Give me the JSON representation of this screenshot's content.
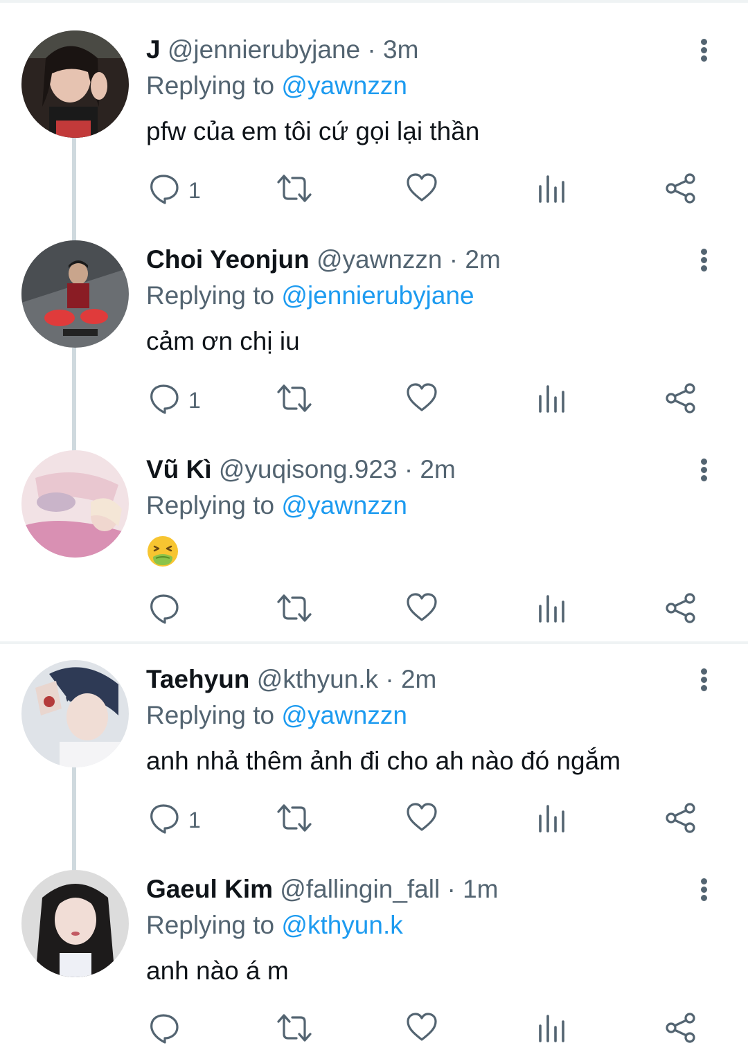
{
  "tweets": [
    {
      "name": "J",
      "handle": "@jennierubyjane",
      "sep": "·",
      "time": "3m",
      "replying_label": "Replying to",
      "replying_to": "@yawnzzn",
      "text": "pfw của em tôi cứ gọi lại thần",
      "reply_count": "1",
      "avatar_colors": [
        "#2b2320",
        "#8a5a4c",
        "#c23a3a"
      ]
    },
    {
      "name": "Choi Yeonjun",
      "handle": "@yawnzzn",
      "sep": "·",
      "time": "2m",
      "replying_label": "Replying to",
      "replying_to": "@jennierubyjane",
      "text": "cảm ơn chị iu",
      "reply_count": "1",
      "avatar_colors": [
        "#5f6366",
        "#3a3d40",
        "#d33"
      ]
    },
    {
      "name": "Vũ Kì",
      "handle": "@yuqisong.923",
      "sep": "·",
      "time": "2m",
      "replying_label": "Replying to",
      "replying_to": "@yawnzzn",
      "text": "",
      "emoji": "nauseated-face",
      "reply_count": "",
      "avatar_colors": [
        "#e9c7d0",
        "#d990b3",
        "#f2e2e5"
      ]
    },
    {
      "name": "Taehyun",
      "handle": "@kthyun.k",
      "sep": "·",
      "time": "2m",
      "replying_label": "Replying to",
      "replying_to": "@yawnzzn",
      "text": "anh nhả thêm ảnh đi cho ah nào đó ngắm",
      "reply_count": "1",
      "avatar_colors": [
        "#2e3a55",
        "#e8d9d4",
        "#b43a3a"
      ]
    },
    {
      "name": "Gaeul Kim",
      "handle": "@fallingin_fall",
      "sep": "·",
      "time": "1m",
      "replying_label": "Replying to",
      "replying_to": "@kthyun.k",
      "text": "anh nào á m",
      "reply_count": "",
      "avatar_colors": [
        "#1d1b1b",
        "#e8d4cf",
        "#c9c9c9"
      ]
    }
  ],
  "icons": {
    "reply": "reply-icon",
    "retweet": "retweet-icon",
    "like": "heart-icon",
    "views": "views-icon",
    "share": "share-icon",
    "more": "more-vertical-icon"
  },
  "colors": {
    "mention": "#1d9bf0",
    "secondary_text": "#536471",
    "primary_text": "#0f1419",
    "connector": "#cfd9de"
  }
}
